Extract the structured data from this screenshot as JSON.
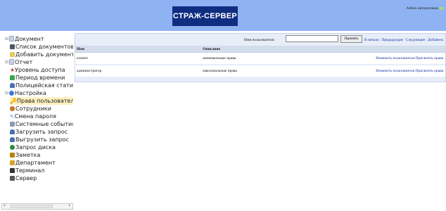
{
  "header": {
    "logo": "СТРАЖ-СЕРВЕР",
    "user_info": "Admin авторизован,"
  },
  "sidebar": {
    "items": [
      {
        "label": "Документ",
        "icon": "document-icon",
        "color": "#9aa7c8"
      },
      {
        "label": "Список документов",
        "icon": "document-list-icon",
        "color": "#4b5566"
      },
      {
        "label": "Добавить документ",
        "icon": "add-document-icon",
        "color": "#c9a23a"
      },
      {
        "label": "Отчет",
        "icon": "report-icon",
        "color": "#9aa7c8"
      },
      {
        "label": "Уровень доступа",
        "icon": "star-icon",
        "color": "#d63a3a"
      },
      {
        "label": "Период времени",
        "icon": "calendar-icon",
        "color": "#3aa84a"
      },
      {
        "label": "Полицейская статистика",
        "icon": "user-icon",
        "color": "#4a6fb3"
      },
      {
        "label": "Настройка",
        "icon": "settings-icon",
        "color": "#3a78d6"
      },
      {
        "label": "Права пользователя",
        "icon": "key-icon",
        "color": "#e0b032"
      },
      {
        "label": "Сотрудники",
        "icon": "employees-icon",
        "color": "#c87a2a"
      },
      {
        "label": "Смена пароля",
        "icon": "password-icon",
        "color": "#4a8fc8"
      },
      {
        "label": "Системные события",
        "icon": "system-events-icon",
        "color": "#8a9ab5"
      },
      {
        "label": "Загрузить запрос",
        "icon": "upload-icon",
        "color": "#4a6fb3"
      },
      {
        "label": "Выгрузить запрос",
        "icon": "download-icon",
        "color": "#4a6fb3"
      },
      {
        "label": "Запрос диска",
        "icon": "disk-icon",
        "color": "#2f8a3a"
      },
      {
        "label": "Заметка",
        "icon": "note-icon",
        "color": "#b8860b"
      },
      {
        "label": "Департамент",
        "icon": "department-icon",
        "color": "#d6a22a"
      },
      {
        "label": "Терминал",
        "icon": "terminal-icon",
        "color": "#333333"
      },
      {
        "label": "Сервер",
        "icon": "server-icon",
        "color": "#555555"
      }
    ],
    "selected": "Права пользователя"
  },
  "toolbar": {
    "search_label": "Имя пользователя:",
    "search_value": "",
    "accept_label": "Принять",
    "nav_first": "В начало",
    "nav_prev": "Предыдущие",
    "nav_next": "Следующие",
    "nav_add": "Добавить"
  },
  "table": {
    "headers": [
      "Имя",
      "Описание",
      ""
    ],
    "rows": [
      {
        "name": "клиент",
        "description": "минимальные права",
        "action": "Изменить пользователя Присвоить права"
      },
      {
        "name": "администратор",
        "description": "максимальные права",
        "action": "Изменить пользователя Присвоить права"
      }
    ]
  },
  "colors": {
    "header_bg": "#8fb3f2",
    "logo_bg": "#0f2e82",
    "panel_bg": "#e7eef8",
    "link": "#1a2fa8"
  }
}
